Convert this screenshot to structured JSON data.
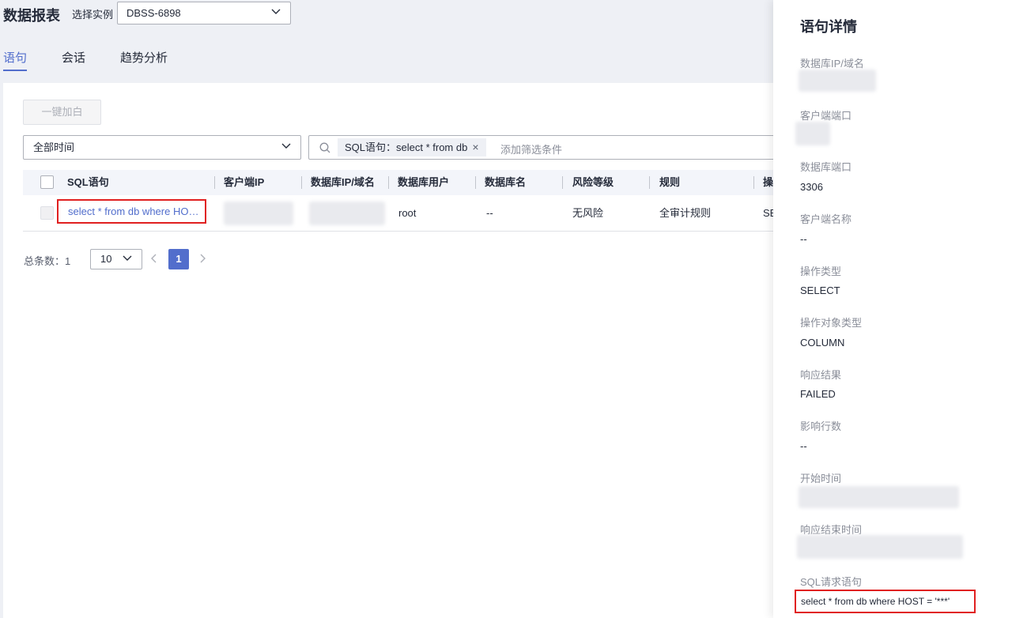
{
  "header": {
    "title": "数据报表",
    "instance_label": "选择实例",
    "instance_value": "DBSS-6898"
  },
  "tabs": [
    {
      "label": "语句",
      "active": true
    },
    {
      "label": "会话",
      "active": false
    },
    {
      "label": "趋势分析",
      "active": false
    }
  ],
  "toolbar": {
    "whitelist_label": "一键加白"
  },
  "filters": {
    "time_value": "全部时间",
    "tag_label": "SQL语句：select * from db",
    "search_placeholder": "添加筛选条件"
  },
  "table": {
    "columns": [
      "SQL语句",
      "客户端IP",
      "数据库IP/域名",
      "数据库用户",
      "数据库名",
      "风险等级",
      "规则",
      "操"
    ],
    "rows": [
      {
        "sql": "select * from db where HO…",
        "client_ip": "",
        "db_host": "",
        "db_user": "root",
        "db_name": "--",
        "risk": "无风险",
        "rule": "全审计规则",
        "op": "SE"
      }
    ]
  },
  "pagination": {
    "total_label": "总条数：1",
    "page_size": "10",
    "current_page": "1"
  },
  "drawer": {
    "title": "语句详情",
    "fields": [
      {
        "label": "数据库IP/域名",
        "value": ""
      },
      {
        "label": "客户端端口",
        "value": ""
      },
      {
        "label": "数据库端口",
        "value": "3306"
      },
      {
        "label": "客户端名称",
        "value": "--"
      },
      {
        "label": "操作类型",
        "value": "SELECT"
      },
      {
        "label": "操作对象类型",
        "value": "COLUMN"
      },
      {
        "label": "响应结果",
        "value": "FAILED"
      },
      {
        "label": "影响行数",
        "value": "--"
      },
      {
        "label": "开始时间",
        "value": ""
      },
      {
        "label": "响应结束时间",
        "value": ""
      },
      {
        "label": "SQL请求语句",
        "value": "select * from db where HOST = '***'"
      }
    ]
  },
  "colors": {
    "accent": "#526ecc",
    "highlight_border": "#e02020"
  }
}
